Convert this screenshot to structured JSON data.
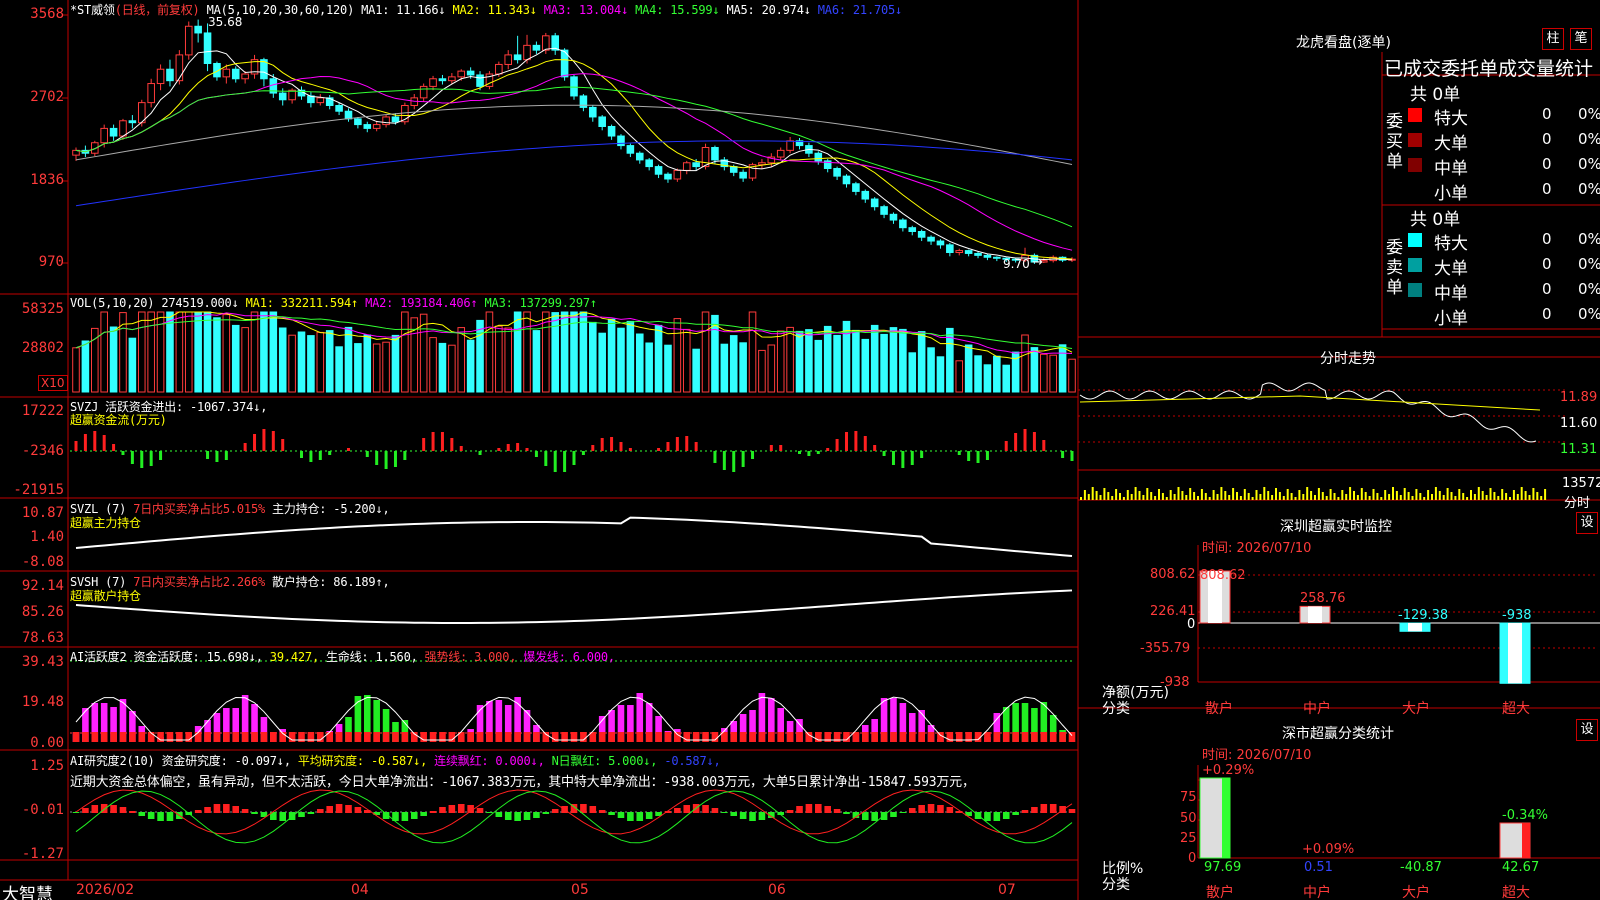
{
  "stock": {
    "name": "*ST威领",
    "period": "(日线，前复权)"
  },
  "main_axis": [
    "3568",
    "2702",
    "1836",
    "970"
  ],
  "main_high_label": "35.68",
  "main_low_label": "9.70",
  "ma_header": {
    "title": "MA(5,10,20,30,60,120)",
    "ma1": "MA1: 11.166↓",
    "ma2": "MA2: 11.343↓",
    "ma3": "MA3: 13.004↓",
    "ma4": "MA4: 15.599↓",
    "ma5": "MA5: 20.974↓",
    "ma6": "MA6: 21.705↓"
  },
  "vol_header": {
    "title": "VOL(5,10,20)",
    "value": "274519.000↓",
    "ma1": "MA1: 332211.594↑",
    "ma2": "MA2: 193184.406↑",
    "ma3": "MA3: 137299.297↑"
  },
  "vol_axis": [
    "58325",
    "28802"
  ],
  "vol_unit": "X10",
  "svzj": {
    "title": "SVZJ",
    "line1": "活跃资金进出: -1067.374↓,",
    "line2": "超赢资金流(万元)",
    "axis": [
      "17222",
      "-2346",
      "-21915"
    ]
  },
  "svzl": {
    "title": "SVZL (7)",
    "a": "7日内买卖净占比5.015%",
    "b": "主力持仓: -5.200↓,",
    "line2": "超赢主力持仓",
    "axis": [
      "10.87",
      "1.40",
      "-8.08"
    ]
  },
  "svsh": {
    "title": "SVSH (7)",
    "a": "7日内买卖净占比2.266%",
    "b": "散户持仓: 86.189↑,",
    "line2": "超赢散户持仓",
    "axis": [
      "92.14",
      "85.26",
      "78.63"
    ]
  },
  "ai1": {
    "title": "AI活跃度2",
    "a": "资金活跃度: 15.698↓,",
    "b": "39.427,",
    "c": "生命线: 1.560,",
    "d": "强势线: 3.000,",
    "e": "爆发线: 6.000,",
    "axis": [
      "39.43",
      "19.48",
      "0.00"
    ]
  },
  "ai2": {
    "title": "AI研究度2(10)",
    "a": "资金研究度: -0.097↓,",
    "b": "平均研究度: -0.587↓,",
    "c": "连续飘红: 0.000↓,",
    "d": "N日飘红: 5.000↓,",
    "e": "-0.587↓,",
    "text": "近期大资金总体偏空，虽有异动，但不太活跃，今日大单净流出：-1067.383万元，其中特大单净流出：-938.003万元，大单5日累计净出-15847.593万元，",
    "axis": [
      "1.25",
      "-0.01",
      "-1.27"
    ]
  },
  "xaxis": {
    "brand": "大智慧",
    "labels": [
      "2026/02",
      "04",
      "05",
      "06",
      "07"
    ]
  },
  "right": {
    "dragon_title": "龙虎看盘(逐单)",
    "btn_bar": "柱",
    "btn_pen": "笔",
    "stats_title": "已成交委托单成交量统计",
    "buy_group": "委买单",
    "sell_group": "委卖单",
    "buy_total": "共 0单",
    "sell_total": "共 0单",
    "buy_rows": [
      {
        "label": "特大",
        "value": "0",
        "pct": "0%",
        "color": "#ff0000"
      },
      {
        "label": "大单",
        "value": "0",
        "pct": "0%",
        "color": "#a00000"
      },
      {
        "label": "中单",
        "value": "0",
        "pct": "0%",
        "color": "#800000"
      },
      {
        "label": "小单",
        "value": "0",
        "pct": "0%",
        "color": ""
      }
    ],
    "sell_rows": [
      {
        "label": "特大",
        "value": "0",
        "pct": "0%",
        "color": "#00ffff"
      },
      {
        "label": "大单",
        "value": "0",
        "pct": "0%",
        "color": "#00a0a0"
      },
      {
        "label": "中单",
        "value": "0",
        "pct": "0%",
        "color": "#008080"
      },
      {
        "label": "小单",
        "value": "0",
        "pct": "0%",
        "color": ""
      }
    ],
    "fenshi_title": "分时走势",
    "fenshi_axis": [
      "11.89",
      "11.60",
      "11.31"
    ],
    "fenshi_vol": "13572",
    "fenshi_label": "分时",
    "sz_title": "深圳超赢实时监控",
    "sz_time": "时间: 2026/07/10",
    "sz_btn": "设",
    "sz_axis": [
      "808.62",
      "226.41",
      "0",
      "-355.79",
      "-938"
    ],
    "sz_ylabel": "净额(万元)",
    "sz_xlabel": "分类",
    "sz_cats": [
      "散户",
      "中户",
      "大户",
      "超大"
    ],
    "sz_vals": [
      "808.62",
      "258.76",
      "-129.38",
      "-938"
    ],
    "sf_title": "深市超赢分类统计",
    "sf_time": "时间: 2026/07/10",
    "sf_btn": "设",
    "sf_axis": [
      "75",
      "50",
      "25",
      "0"
    ],
    "sf_ylabel": "比例%",
    "sf_xlabel": "分类",
    "sf_cats": [
      "散户",
      "中户",
      "大户",
      "超大"
    ],
    "sf_top": [
      "+0.29%",
      "+0.09%",
      "",
      "-0.34%"
    ],
    "sf_vals": [
      "97.69",
      "0.51",
      "-40.87",
      "42.67"
    ]
  },
  "chart_data": {
    "type": "candlestick",
    "title": "*ST威领 (日线，前复权)",
    "price_axis": [
      970,
      1836,
      2702,
      3568
    ],
    "candles": [
      [
        2100,
        2150,
        2060,
        2180,
        2040
      ],
      [
        2150,
        2120,
        2140,
        2200,
        2080
      ],
      [
        2120,
        2230,
        2100,
        2250,
        2090
      ],
      [
        2230,
        2380,
        2200,
        2420,
        2180
      ],
      [
        2380,
        2300,
        2260,
        2420,
        2250
      ],
      [
        2300,
        2460,
        2280,
        2480,
        2260
      ],
      [
        2460,
        2440,
        2400,
        2520,
        2380
      ],
      [
        2440,
        2650,
        2420,
        2680,
        2400
      ],
      [
        2650,
        2850,
        2620,
        2900,
        2600
      ],
      [
        2850,
        3000,
        2820,
        3050,
        2780
      ],
      [
        3000,
        2880,
        2860,
        3100,
        2820
      ],
      [
        2880,
        3150,
        2860,
        3200,
        2840
      ],
      [
        3150,
        3450,
        3120,
        3500,
        3100
      ],
      [
        3450,
        3380,
        3300,
        3520,
        3280
      ],
      [
        3380,
        3060,
        3000,
        3480,
        2980
      ],
      [
        3060,
        2920,
        2900,
        3080,
        2880
      ],
      [
        2920,
        3000,
        2880,
        3050,
        2850
      ],
      [
        3000,
        2900,
        2880,
        3030,
        2860
      ],
      [
        2900,
        2950,
        2880,
        2980,
        2850
      ],
      [
        2950,
        3100,
        2930,
        3150,
        2900
      ],
      [
        3100,
        2900,
        2850,
        3120,
        2820
      ],
      [
        2900,
        2750,
        2720,
        2950,
        2700
      ],
      [
        2750,
        2680,
        2650,
        2800,
        2620
      ],
      [
        2680,
        2780,
        2650,
        2800,
        2640
      ],
      [
        2780,
        2720,
        2700,
        2820,
        2680
      ],
      [
        2720,
        2650,
        2630,
        2760,
        2600
      ],
      [
        2650,
        2700,
        2630,
        2740,
        2620
      ],
      [
        2700,
        2620,
        2600,
        2730,
        2580
      ],
      [
        2620,
        2560,
        2540,
        2650,
        2520
      ],
      [
        2560,
        2480,
        2460,
        2590,
        2450
      ],
      [
        2480,
        2420,
        2400,
        2500,
        2380
      ],
      [
        2420,
        2380,
        2360,
        2450,
        2340
      ],
      [
        2380,
        2420,
        2360,
        2460,
        2350
      ],
      [
        2420,
        2500,
        2400,
        2520,
        2390
      ],
      [
        2500,
        2450,
        2430,
        2540,
        2420
      ],
      [
        2450,
        2620,
        2430,
        2650,
        2420
      ],
      [
        2620,
        2700,
        2600,
        2740,
        2580
      ],
      [
        2700,
        2820,
        2680,
        2850,
        2660
      ],
      [
        2820,
        2900,
        2800,
        2930,
        2780
      ],
      [
        2900,
        2880,
        2860,
        2940,
        2840
      ],
      [
        2880,
        2920,
        2860,
        2960,
        2840
      ],
      [
        2920,
        2980,
        2900,
        3000,
        2880
      ],
      [
        2980,
        2940,
        2920,
        3020,
        2900
      ],
      [
        2940,
        2820,
        2800,
        2980,
        2780
      ],
      [
        2820,
        2950,
        2800,
        2980,
        2790
      ],
      [
        2950,
        3050,
        2930,
        3080,
        2920
      ],
      [
        3050,
        3150,
        3020,
        3200,
        3000
      ],
      [
        3150,
        3100,
        3080,
        3350,
        3060
      ],
      [
        3100,
        3250,
        3080,
        3360,
        3060
      ],
      [
        3250,
        3200,
        3180,
        3290,
        3160
      ],
      [
        3200,
        3350,
        3180,
        3380,
        3160
      ],
      [
        3350,
        3200,
        3180,
        3380,
        3150
      ],
      [
        3200,
        2920,
        2900,
        3220,
        2880
      ],
      [
        2920,
        2720,
        2700,
        2940,
        2680
      ],
      [
        2720,
        2600,
        2580,
        2740,
        2560
      ],
      [
        2600,
        2500,
        2480,
        2620,
        2450
      ],
      [
        2500,
        2400,
        2380,
        2520,
        2360
      ],
      [
        2400,
        2300,
        2280,
        2420,
        2260
      ],
      [
        2300,
        2200,
        2180,
        2320,
        2160
      ],
      [
        2200,
        2120,
        2100,
        2220,
        2080
      ],
      [
        2120,
        2050,
        2030,
        2140,
        2010
      ],
      [
        2050,
        1980,
        1960,
        2070,
        1940
      ],
      [
        1980,
        1900,
        1880,
        2000,
        1860
      ],
      [
        1900,
        1850,
        1830,
        1920,
        1810
      ],
      [
        1850,
        1940,
        1830,
        1960,
        1820
      ],
      [
        1940,
        2020,
        1920,
        2040,
        1900
      ],
      [
        2020,
        1980,
        1960,
        2060,
        1940
      ],
      [
        1980,
        2180,
        1960,
        2220,
        1950
      ],
      [
        2180,
        2050,
        2030,
        2200,
        2010
      ],
      [
        2050,
        1980,
        1960,
        2080,
        1940
      ],
      [
        1980,
        1920,
        1900,
        2000,
        1880
      ],
      [
        1920,
        1860,
        1840,
        1950,
        1820
      ],
      [
        1860,
        2000,
        1840,
        2020,
        1830
      ],
      [
        2000,
        2020,
        1980,
        2060,
        1960
      ],
      [
        2020,
        2080,
        2000,
        2120,
        1980
      ],
      [
        2080,
        2150,
        2060,
        2180,
        2050
      ],
      [
        2150,
        2250,
        2130,
        2290,
        2120
      ],
      [
        2250,
        2200,
        2180,
        2280,
        2160
      ],
      [
        2200,
        2120,
        2100,
        2230,
        2080
      ],
      [
        2120,
        2040,
        2020,
        2140,
        2000
      ],
      [
        2040,
        1960,
        1940,
        2060,
        1920
      ],
      [
        1960,
        1880,
        1860,
        1980,
        1840
      ],
      [
        1880,
        1800,
        1780,
        1900,
        1760
      ],
      [
        1800,
        1720,
        1700,
        1820,
        1680
      ],
      [
        1720,
        1640,
        1620,
        1740,
        1600
      ],
      [
        1640,
        1560,
        1540,
        1660,
        1520
      ],
      [
        1560,
        1480,
        1460,
        1580,
        1440
      ],
      [
        1480,
        1420,
        1400,
        1500,
        1380
      ],
      [
        1420,
        1340,
        1320,
        1440,
        1300
      ],
      [
        1340,
        1300,
        1280,
        1360,
        1260
      ],
      [
        1300,
        1240,
        1220,
        1320,
        1200
      ],
      [
        1240,
        1200,
        1180,
        1260,
        1160
      ],
      [
        1200,
        1160,
        1140,
        1220,
        1120
      ],
      [
        1160,
        1080,
        1060,
        1180,
        1040
      ],
      [
        1080,
        1100,
        1060,
        1120,
        1050
      ],
      [
        1100,
        1070,
        1060,
        1110,
        1040
      ],
      [
        1070,
        1050,
        1040,
        1090,
        1020
      ],
      [
        1050,
        1030,
        1020,
        1070,
        1000
      ],
      [
        1030,
        1020,
        1000,
        1040,
        990
      ],
      [
        1020,
        1010,
        990,
        1030,
        980
      ],
      [
        1010,
        1000,
        990,
        1020,
        975
      ],
      [
        1000,
        1050,
        990,
        1130,
        980
      ],
      [
        1050,
        980,
        970,
        1070,
        960
      ],
      [
        980,
        995,
        975,
        1020,
        970
      ],
      [
        995,
        1030,
        985,
        1050,
        975
      ],
      [
        1030,
        1000,
        990,
        1040,
        980
      ],
      [
        1000,
        1010,
        990,
        1030,
        980
      ]
    ],
    "note": "candles as [open, close, low_body_ref, high, low] in price-axis units"
  }
}
